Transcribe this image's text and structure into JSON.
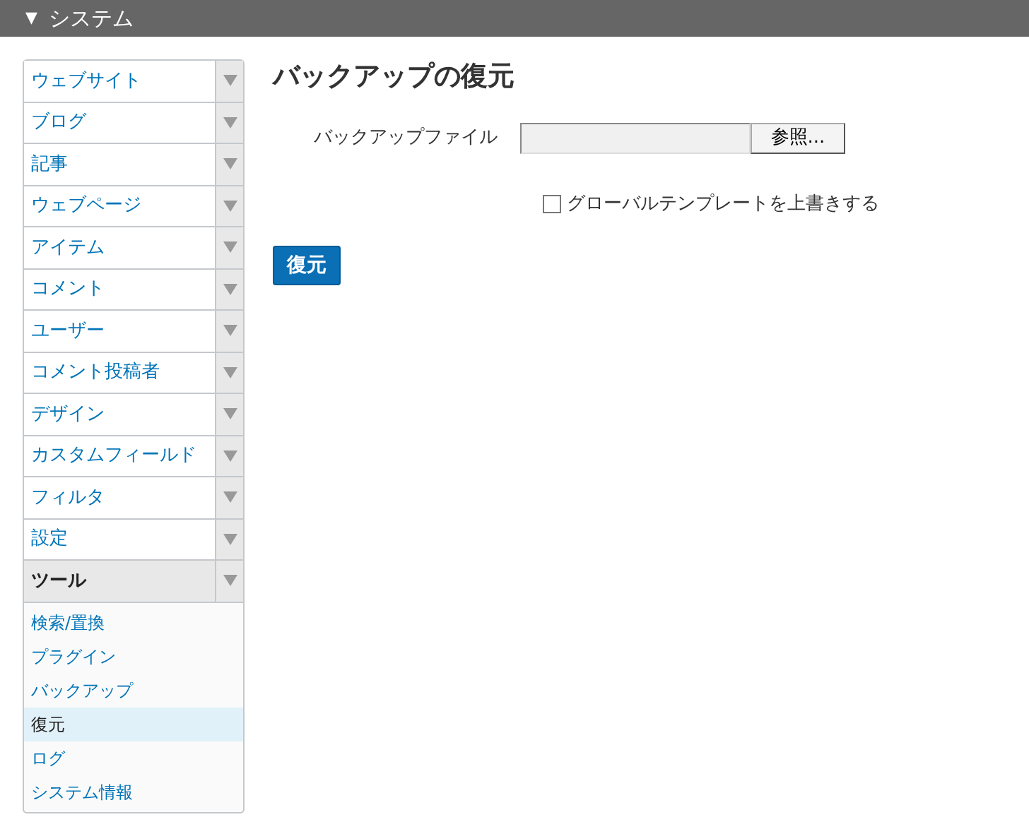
{
  "header": {
    "icon": "▼",
    "title": "システム"
  },
  "sidebar": {
    "items": [
      {
        "label": "ウェブサイト",
        "expanded": false
      },
      {
        "label": "ブログ",
        "expanded": false
      },
      {
        "label": "記事",
        "expanded": false
      },
      {
        "label": "ウェブページ",
        "expanded": false
      },
      {
        "label": "アイテム",
        "expanded": false
      },
      {
        "label": "コメント",
        "expanded": false
      },
      {
        "label": "ユーザー",
        "expanded": false
      },
      {
        "label": "コメント投稿者",
        "expanded": false
      },
      {
        "label": "デザイン",
        "expanded": false
      },
      {
        "label": "カスタムフィールド",
        "expanded": false
      },
      {
        "label": "フィルタ",
        "expanded": false
      },
      {
        "label": "設定",
        "expanded": false
      },
      {
        "label": "ツール",
        "expanded": true,
        "children": [
          {
            "label": "検索/置換",
            "selected": false
          },
          {
            "label": "プラグイン",
            "selected": false
          },
          {
            "label": "バックアップ",
            "selected": false
          },
          {
            "label": "復元",
            "selected": true
          },
          {
            "label": "ログ",
            "selected": false
          },
          {
            "label": "システム情報",
            "selected": false
          }
        ]
      }
    ]
  },
  "page": {
    "title": "バックアップの復元",
    "file_field": {
      "label": "バックアップファイル",
      "button": "参照..."
    },
    "overwrite": {
      "label": "グローバルテンプレートを上書きする",
      "checked": false
    },
    "submit": "復元"
  }
}
